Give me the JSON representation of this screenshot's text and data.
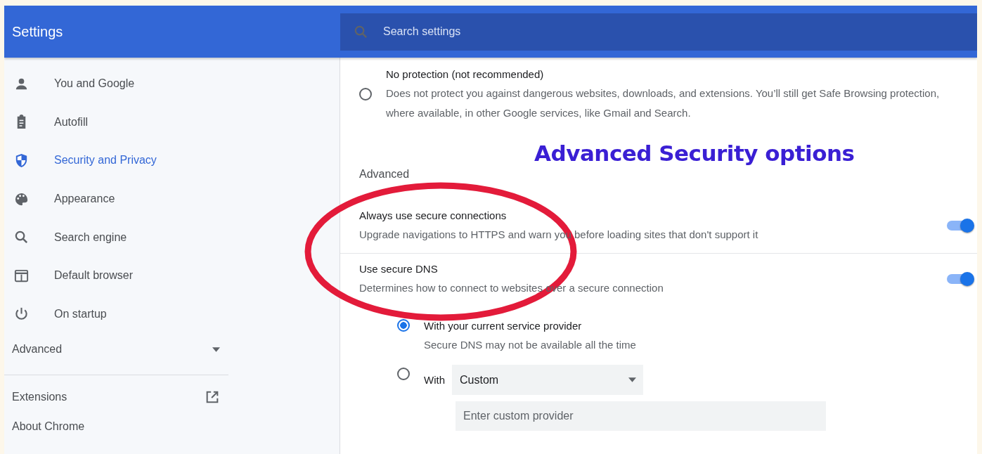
{
  "header": {
    "title": "Settings",
    "search": {
      "placeholder": "Search settings"
    }
  },
  "sidebar": {
    "items": [
      {
        "label": "You and Google",
        "selected": false
      },
      {
        "label": "Autofill",
        "selected": false
      },
      {
        "label": "Security and Privacy",
        "selected": true
      },
      {
        "label": "Appearance",
        "selected": false
      },
      {
        "label": "Search engine",
        "selected": false
      },
      {
        "label": "Default browser",
        "selected": false
      },
      {
        "label": "On startup",
        "selected": false
      }
    ],
    "advanced": {
      "label": "Advanced",
      "expanded": false
    },
    "links": [
      {
        "label": "Extensions",
        "external": true
      },
      {
        "label": "About Chrome",
        "external": false
      }
    ]
  },
  "main": {
    "protection_option": {
      "title": "No protection (not recommended)",
      "description": "Does not protect you against dangerous websites, downloads, and extensions. You’ll still get Safe Browsing protection, where available, in other Google services, like Gmail and Search.",
      "selected": false
    },
    "section_title": "Advanced",
    "toggles": [
      {
        "title": "Always use secure connections",
        "description": "Upgrade navigations to HTTPS and warn you before loading sites that don't support it",
        "on": true
      },
      {
        "title": "Use secure DNS",
        "description": "Determines how to connect to websites over a secure connection",
        "on": true
      }
    ],
    "dns_options": [
      {
        "kind": "plain",
        "label": "With your current service provider",
        "description": "Secure DNS may not be available all the time",
        "selected": true
      },
      {
        "kind": "custom",
        "label": "With",
        "dropdown": "Custom",
        "placeholder": "Enter custom provider",
        "selected": false
      }
    ]
  },
  "annotation": {
    "heading": "Advanced Security options"
  }
}
